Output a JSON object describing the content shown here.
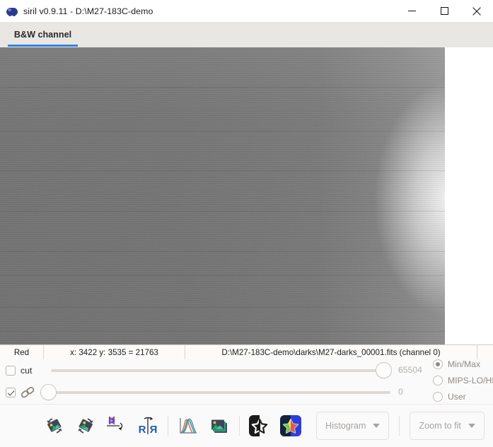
{
  "window": {
    "title": "siril v0.9.11 - D:\\M27-183C-demo",
    "app_icon": "siril-icon",
    "controls": {
      "minimize": "minimize-icon",
      "maximize": "maximize-icon",
      "close": "close-icon"
    }
  },
  "tabs": [
    {
      "label": "B&W channel",
      "active": true
    }
  ],
  "accent_color": "#3584e4",
  "image": {
    "description": "dark-frame-preview",
    "alt": "noisy grayscale dark frame with amplifier glow at right edge"
  },
  "statusbar": {
    "channel": "Red",
    "pixel_readout": "x: 3422 y: 3535 = 21763",
    "file_path": "D:\\M27-183C-demo\\darks\\M27-darks_00001.fits (channel 0)"
  },
  "display_controls": {
    "cut": {
      "label": "cut",
      "checked": false
    },
    "link": {
      "icon": "chain-link-icon",
      "checked": true
    },
    "hi_slider": {
      "value": "65504",
      "position_pct": 93
    },
    "lo_slider": {
      "value": "0",
      "position_pct": 0
    },
    "modes": [
      {
        "label": "Min/Max",
        "selected": true
      },
      {
        "label": "MIPS-LO/HI",
        "selected": false
      },
      {
        "label": "User",
        "selected": false
      }
    ]
  },
  "toolbar": {
    "buttons": [
      {
        "name": "rotate-ccw-button",
        "icon": "rotate-counterclockwise-icon"
      },
      {
        "name": "rotate-cw-button",
        "icon": "rotate-clockwise-icon"
      },
      {
        "name": "mirror-vertical-button",
        "icon": "mirror-vertical-icon"
      },
      {
        "name": "mirror-horizontal-button",
        "icon": "mirror-horizontal-icon"
      },
      {
        "name": "histogram-transform-button",
        "icon": "histogram-curves-icon"
      },
      {
        "name": "image-stack-button",
        "icon": "image-stack-icon"
      },
      {
        "name": "bw-star-button",
        "icon": "star-bw-icon"
      },
      {
        "name": "color-star-button",
        "icon": "star-color-icon"
      }
    ],
    "histogram_dropdown": {
      "label": "Histogram",
      "enabled": false
    },
    "zoom_dropdown": {
      "label": "Zoom to fit",
      "enabled": false
    }
  }
}
